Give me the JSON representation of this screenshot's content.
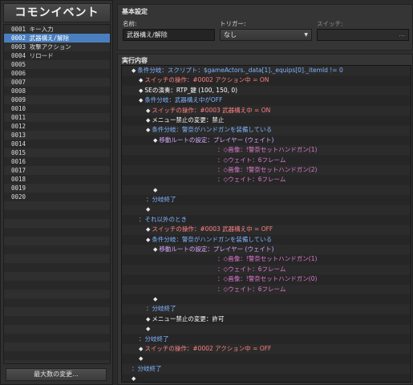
{
  "left": {
    "title": "コモンイベント",
    "events": [
      "0001 キー入力",
      "0002 武器構え/解除",
      "0003 攻撃アクション",
      "0004 リロード",
      "0005",
      "0006",
      "0007",
      "0008",
      "0009",
      "0010",
      "0011",
      "0012",
      "0013",
      "0014",
      "0015",
      "0016",
      "0017",
      "0018",
      "0019",
      "0020"
    ],
    "selected_index": 1,
    "max_button": "最大数の変更..."
  },
  "basic": {
    "section_title": "基本設定",
    "name_label": "名前:",
    "name_value": "武器構え/解除",
    "trigger_label": "トリガー:",
    "trigger_value": "なし",
    "switch_label": "スイッチ:",
    "switch_value": "",
    "switch_button": "..."
  },
  "commands": {
    "section_title": "実行内容",
    "lines": [
      {
        "indent": 0,
        "diamond": true,
        "type": "cond",
        "text": "条件分岐：スクリプト：$gameActors._data[1]._equips[0]._itemId != 0"
      },
      {
        "indent": 1,
        "diamond": true,
        "type": "switch",
        "text": "スイッチの操作：#0002 アクション中 = ON"
      },
      {
        "indent": 1,
        "diamond": true,
        "type": "se",
        "text": "SEの演奏：RTP_鍵 (100, 150, 0)"
      },
      {
        "indent": 1,
        "diamond": true,
        "type": "cond",
        "text": "条件分岐：武器構え中がOFF"
      },
      {
        "indent": 2,
        "diamond": true,
        "type": "switch",
        "text": "スイッチの操作：#0003 武器構え中 = ON"
      },
      {
        "indent": 2,
        "diamond": true,
        "type": "menu",
        "text": "メニュー禁止の変更：禁止"
      },
      {
        "indent": 2,
        "diamond": true,
        "type": "cond",
        "text": "条件分岐：警奈がハンドガンを装備している"
      },
      {
        "indent": 3,
        "diamond": true,
        "type": "move",
        "text": "移動ルートの設定：プレイヤー (ウェイト)"
      },
      {
        "indent": 3,
        "diamond": false,
        "type": "sub",
        "colon": true,
        "text": "：◇画像：!警奈セットハンドガン(1)"
      },
      {
        "indent": 3,
        "diamond": false,
        "type": "sub",
        "colon": true,
        "text": "：◇ウェイト：6フレーム"
      },
      {
        "indent": 3,
        "diamond": false,
        "type": "sub",
        "colon": true,
        "text": "：◇画像：!警奈セットハンドガン(2)"
      },
      {
        "indent": 3,
        "diamond": false,
        "type": "sub",
        "colon": true,
        "text": "：◇ウェイト：6フレーム"
      },
      {
        "indent": 3,
        "diamond": true,
        "type": "empty",
        "text": ""
      },
      {
        "indent": 2,
        "diamond": false,
        "type": "end",
        "text": "：分岐終了"
      },
      {
        "indent": 2,
        "diamond": true,
        "type": "empty",
        "text": ""
      },
      {
        "indent": 1,
        "diamond": false,
        "type": "else",
        "text": "：それ以外のとき"
      },
      {
        "indent": 2,
        "diamond": true,
        "type": "switch",
        "text": "スイッチの操作：#0003 武器構え中 = OFF"
      },
      {
        "indent": 2,
        "diamond": true,
        "type": "cond",
        "text": "条件分岐：警奈がハンドガンを装備している"
      },
      {
        "indent": 3,
        "diamond": true,
        "type": "move",
        "text": "移動ルートの設定：プレイヤー (ウェイト)"
      },
      {
        "indent": 3,
        "diamond": false,
        "type": "sub",
        "colon": true,
        "text": "：◇画像：!警奈セットハンドガン(1)"
      },
      {
        "indent": 3,
        "diamond": false,
        "type": "sub",
        "colon": true,
        "text": "：◇ウェイト：6フレーム"
      },
      {
        "indent": 3,
        "diamond": false,
        "type": "sub",
        "colon": true,
        "text": "：◇画像：!警奈セットハンドガン(0)"
      },
      {
        "indent": 3,
        "diamond": false,
        "type": "sub",
        "colon": true,
        "text": "：◇ウェイト：6フレーム"
      },
      {
        "indent": 3,
        "diamond": true,
        "type": "empty",
        "text": ""
      },
      {
        "indent": 2,
        "diamond": false,
        "type": "end",
        "text": "：分岐終了"
      },
      {
        "indent": 2,
        "diamond": true,
        "type": "menu",
        "text": "メニュー禁止の変更：許可"
      },
      {
        "indent": 2,
        "diamond": true,
        "type": "empty",
        "text": ""
      },
      {
        "indent": 1,
        "diamond": false,
        "type": "end",
        "text": "：分岐終了"
      },
      {
        "indent": 1,
        "diamond": true,
        "type": "switch",
        "text": "スイッチの操作：#0002 アクション中 = OFF"
      },
      {
        "indent": 1,
        "diamond": true,
        "type": "empty",
        "text": ""
      },
      {
        "indent": 0,
        "diamond": false,
        "type": "end",
        "text": "：分岐終了"
      },
      {
        "indent": 0,
        "diamond": true,
        "type": "empty",
        "text": ""
      }
    ]
  }
}
